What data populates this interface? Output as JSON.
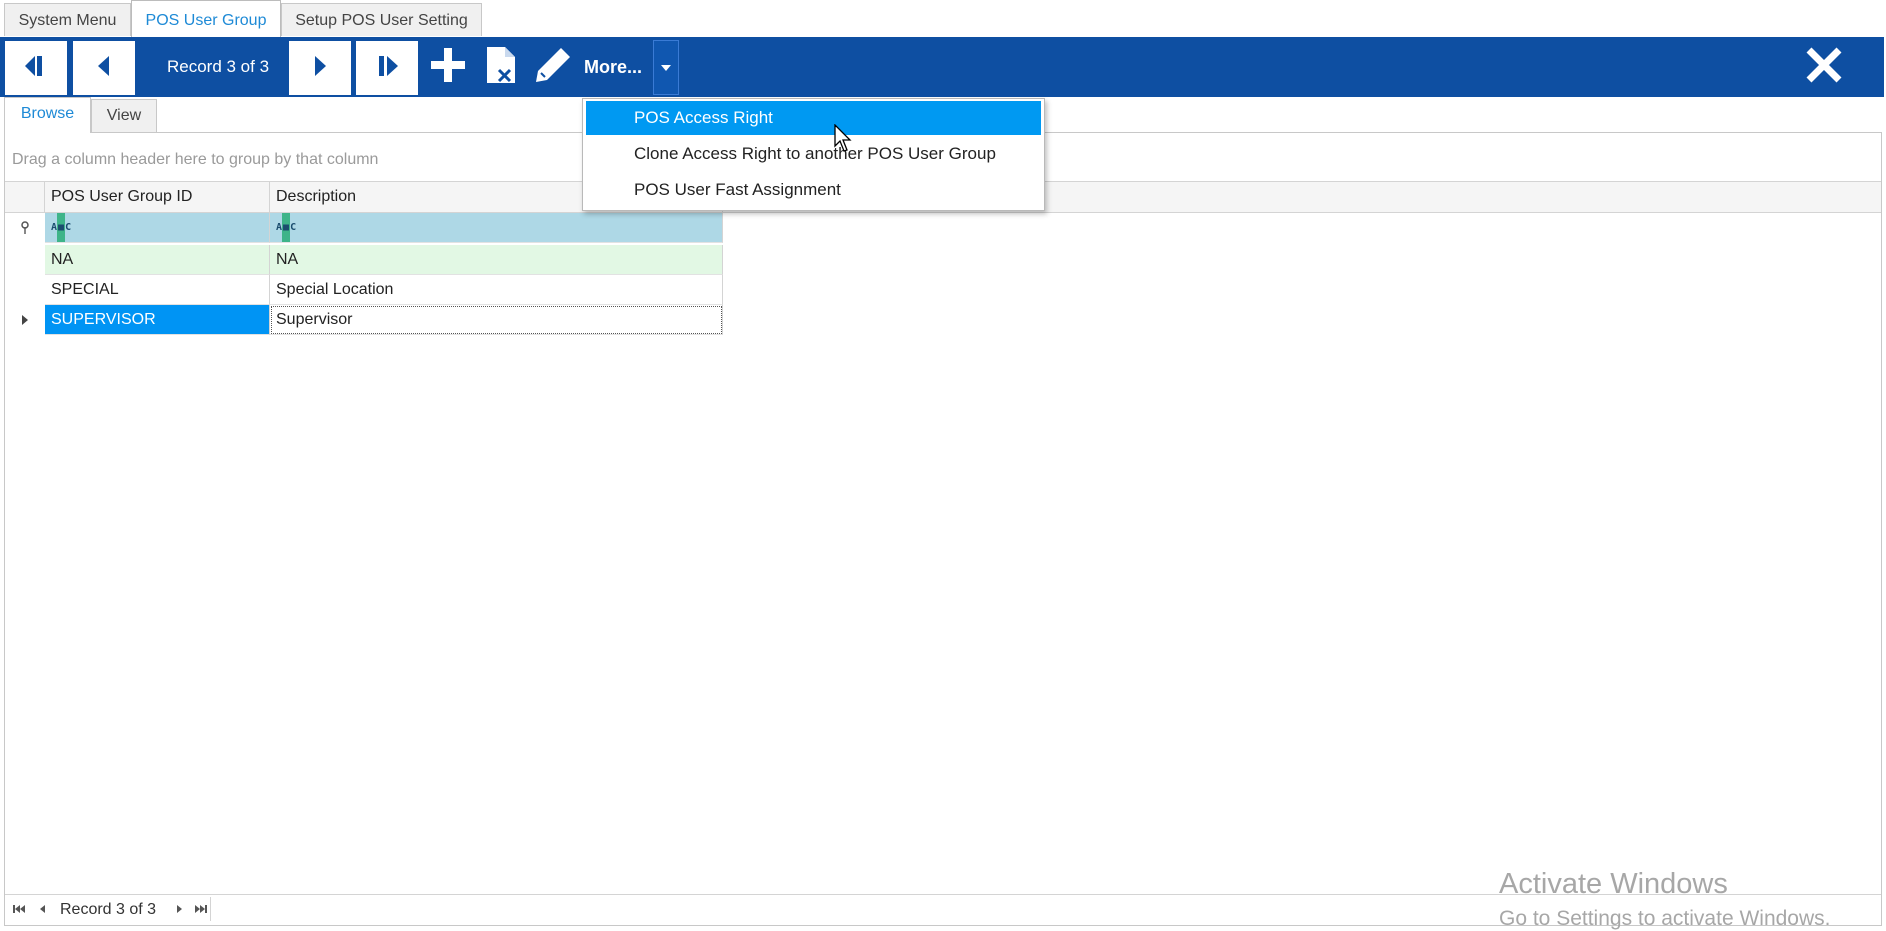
{
  "doc_tabs": [
    {
      "label": "System Menu"
    },
    {
      "label": "POS User Group"
    },
    {
      "label": "Setup POS User Setting"
    }
  ],
  "toolbar": {
    "record_label": "Record 3 of 3",
    "more_label": "More..."
  },
  "sub_tabs": [
    {
      "label": "Browse"
    },
    {
      "label": "View"
    }
  ],
  "grid": {
    "group_panel_hint": "Drag a column header here to group by that column",
    "columns": [
      "POS User Group ID",
      "Description"
    ],
    "filter_icon_text": "A C",
    "rows": [
      {
        "id": "NA",
        "description": "NA"
      },
      {
        "id": "SPECIAL",
        "description": "Special Location"
      },
      {
        "id": "SUPERVISOR",
        "description": "Supervisor"
      }
    ],
    "selected_row_index": 2
  },
  "footer": {
    "record_label": "Record 3 of 3"
  },
  "more_menu": {
    "items": [
      {
        "label": "POS Access Right",
        "highlighted": true
      },
      {
        "label": "Clone Access Right to another POS User Group",
        "highlighted": false
      },
      {
        "label": "POS User Fast Assignment",
        "highlighted": false
      }
    ]
  },
  "watermark": {
    "line1": "Activate Windows",
    "line2": "Go to Settings to activate Windows."
  },
  "colors": {
    "toolbar_bg": "#0e4fa2",
    "accent": "#1e8ad6",
    "selection": "#0094f4",
    "menu_highlight": "#0099f2",
    "filter_row": "#aed8e6",
    "alt_row": "#e2f8e4"
  },
  "icons": {
    "first": "first-record-icon",
    "prev": "previous-record-icon",
    "next": "next-record-icon",
    "last": "last-record-icon",
    "add": "plus-icon",
    "delete": "delete-document-icon",
    "edit": "pencil-icon",
    "close": "close-icon",
    "dropdown": "chevron-down-icon",
    "filter": "pin-icon",
    "row_indicator": "row-pointer-icon"
  }
}
